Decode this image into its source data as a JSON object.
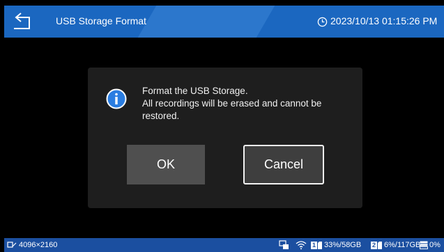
{
  "header": {
    "title": "USB Storage Format",
    "datetime": "2023/10/13 01:15:26 PM"
  },
  "dialog": {
    "message_line1": "Format the USB Storage.",
    "message_line2": "All recordings will be erased and cannot be",
    "message_line3": "restored.",
    "ok_label": "OK",
    "cancel_label": "Cancel"
  },
  "status_bar": {
    "resolution": "4096×2160",
    "slot1_label": "1",
    "slot1_usage": "33%/58GB",
    "slot2_label": "2",
    "slot2_usage": "6%/117GB",
    "storage_usage": "0%"
  },
  "colors": {
    "header_blue": "#1b67c0",
    "status_blue": "#1b4fa0",
    "dialog_bg": "#1e1e1e",
    "info_icon": "#2a7de1"
  }
}
